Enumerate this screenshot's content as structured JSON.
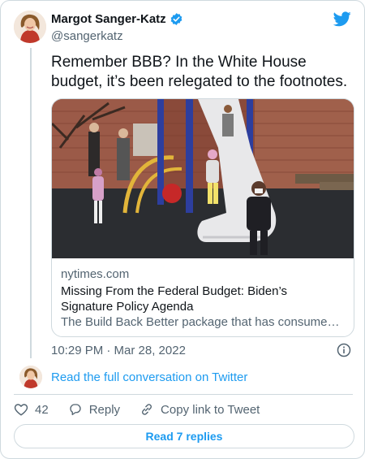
{
  "author": {
    "name": "Margot Sanger-Katz",
    "handle": "@sangerkatz",
    "verified": true
  },
  "tweet": {
    "text": "Remember BBB? In the White House budget, it’s been relegated to the footnotes.",
    "timestamp": "10:29 PM · Mar 28, 2022"
  },
  "link_card": {
    "domain": "nytimes.com",
    "title": "Missing From the Federal Budget: Biden’s Signature Policy Agenda",
    "description": "The Build Back Better package that has consumed Con..."
  },
  "conversation": {
    "label": "Read the full conversation on Twitter"
  },
  "actions": {
    "likes": "42",
    "reply_label": "Reply",
    "copy_label": "Copy link to Tweet"
  },
  "footer": {
    "read_replies": "Read 7 replies"
  },
  "colors": {
    "accent": "#1d9bf0",
    "text": "#0f1419",
    "muted": "#536471",
    "border": "#cfd9de"
  },
  "icons": [
    "verified-badge-icon",
    "twitter-bird-icon",
    "info-icon",
    "heart-icon",
    "reply-icon",
    "link-icon"
  ]
}
